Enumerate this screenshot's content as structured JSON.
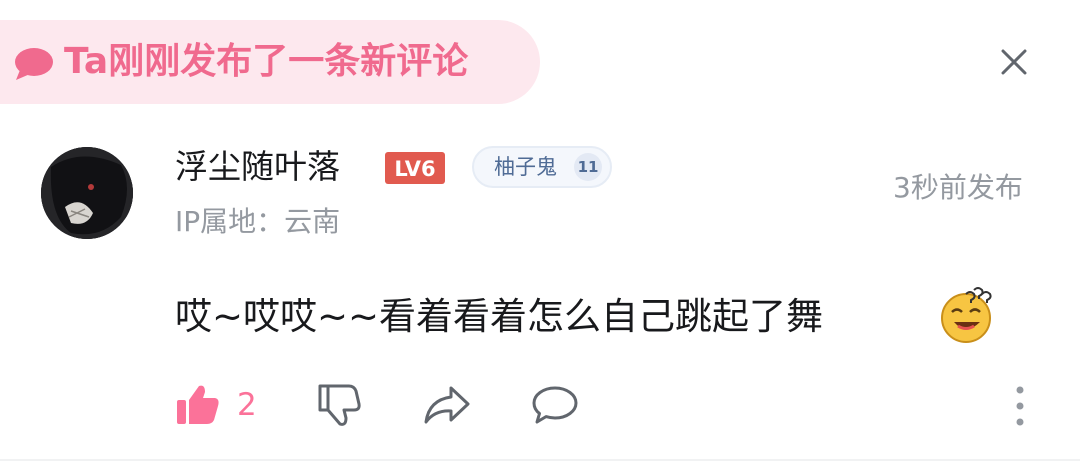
{
  "banner": {
    "text": "Ta刚刚发布了一条新评论"
  },
  "comment": {
    "username": "浮尘随叶落",
    "user_level": "LV6",
    "medal": {
      "name": "柚子鬼",
      "level": "11"
    },
    "ip_location": "IP属地：云南",
    "timestamp": "3秒前发布",
    "text": "哎~哎哎~~看着看着怎么自己跳起了舞",
    "like_count": "2"
  },
  "icons": {
    "banner": "chat-bubble-icon",
    "close": "close-icon",
    "like": "thumbs-up-icon",
    "dislike": "thumbs-down-icon",
    "share": "share-icon",
    "reply": "comment-icon",
    "more": "more-vertical-icon",
    "emoji": "dizzy-face-emoji"
  },
  "colors": {
    "accent": "#fb7299",
    "banner_bg": "#fde8ee",
    "banner_text": "#f06a8e",
    "level_badge": "#e15a4f",
    "secondary_text": "#9499a0",
    "medal_text": "#4f6b95"
  }
}
